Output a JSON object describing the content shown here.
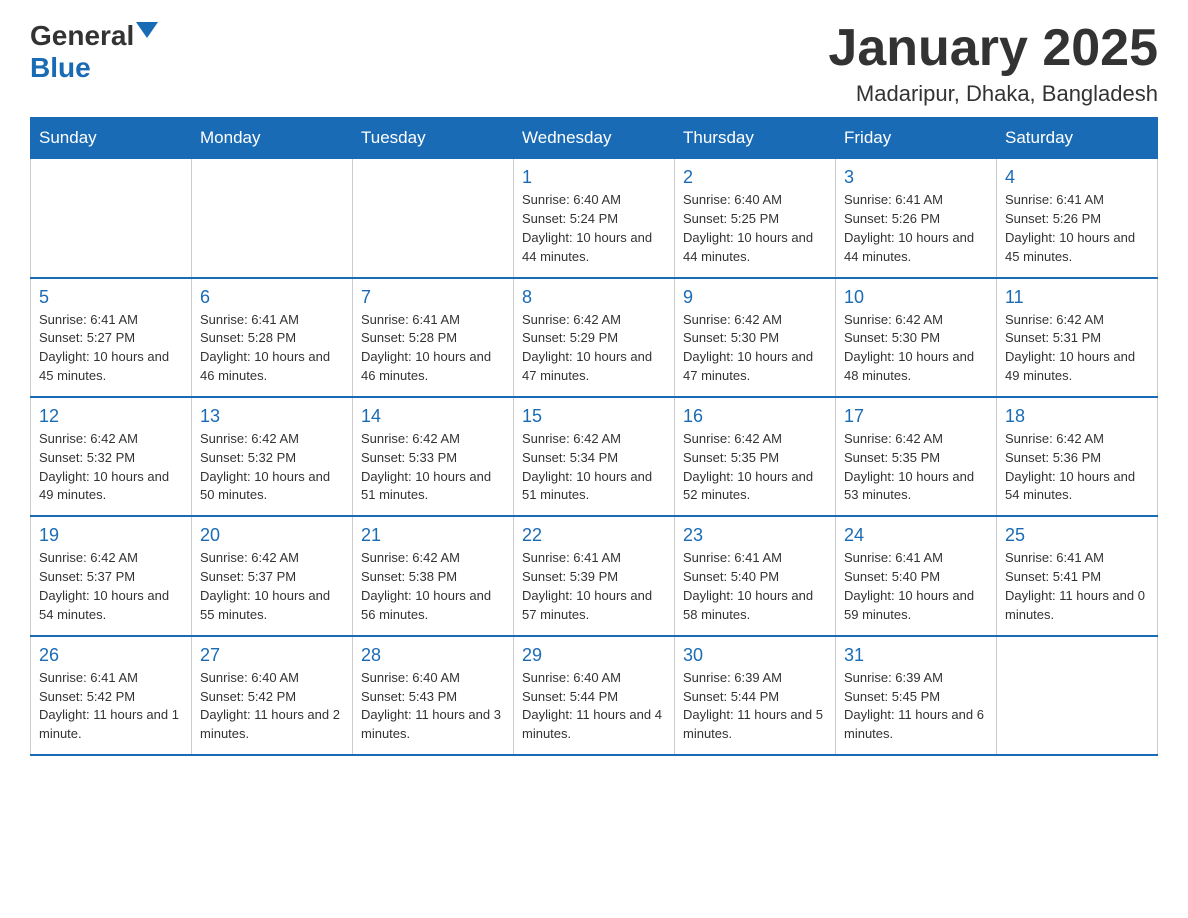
{
  "header": {
    "logo_general": "General",
    "logo_blue": "Blue",
    "title": "January 2025",
    "location": "Madaripur, Dhaka, Bangladesh"
  },
  "days_of_week": [
    "Sunday",
    "Monday",
    "Tuesday",
    "Wednesday",
    "Thursday",
    "Friday",
    "Saturday"
  ],
  "weeks": [
    [
      {
        "day": "",
        "info": ""
      },
      {
        "day": "",
        "info": ""
      },
      {
        "day": "",
        "info": ""
      },
      {
        "day": "1",
        "info": "Sunrise: 6:40 AM\nSunset: 5:24 PM\nDaylight: 10 hours and 44 minutes."
      },
      {
        "day": "2",
        "info": "Sunrise: 6:40 AM\nSunset: 5:25 PM\nDaylight: 10 hours and 44 minutes."
      },
      {
        "day": "3",
        "info": "Sunrise: 6:41 AM\nSunset: 5:26 PM\nDaylight: 10 hours and 44 minutes."
      },
      {
        "day": "4",
        "info": "Sunrise: 6:41 AM\nSunset: 5:26 PM\nDaylight: 10 hours and 45 minutes."
      }
    ],
    [
      {
        "day": "5",
        "info": "Sunrise: 6:41 AM\nSunset: 5:27 PM\nDaylight: 10 hours and 45 minutes."
      },
      {
        "day": "6",
        "info": "Sunrise: 6:41 AM\nSunset: 5:28 PM\nDaylight: 10 hours and 46 minutes."
      },
      {
        "day": "7",
        "info": "Sunrise: 6:41 AM\nSunset: 5:28 PM\nDaylight: 10 hours and 46 minutes."
      },
      {
        "day": "8",
        "info": "Sunrise: 6:42 AM\nSunset: 5:29 PM\nDaylight: 10 hours and 47 minutes."
      },
      {
        "day": "9",
        "info": "Sunrise: 6:42 AM\nSunset: 5:30 PM\nDaylight: 10 hours and 47 minutes."
      },
      {
        "day": "10",
        "info": "Sunrise: 6:42 AM\nSunset: 5:30 PM\nDaylight: 10 hours and 48 minutes."
      },
      {
        "day": "11",
        "info": "Sunrise: 6:42 AM\nSunset: 5:31 PM\nDaylight: 10 hours and 49 minutes."
      }
    ],
    [
      {
        "day": "12",
        "info": "Sunrise: 6:42 AM\nSunset: 5:32 PM\nDaylight: 10 hours and 49 minutes."
      },
      {
        "day": "13",
        "info": "Sunrise: 6:42 AM\nSunset: 5:32 PM\nDaylight: 10 hours and 50 minutes."
      },
      {
        "day": "14",
        "info": "Sunrise: 6:42 AM\nSunset: 5:33 PM\nDaylight: 10 hours and 51 minutes."
      },
      {
        "day": "15",
        "info": "Sunrise: 6:42 AM\nSunset: 5:34 PM\nDaylight: 10 hours and 51 minutes."
      },
      {
        "day": "16",
        "info": "Sunrise: 6:42 AM\nSunset: 5:35 PM\nDaylight: 10 hours and 52 minutes."
      },
      {
        "day": "17",
        "info": "Sunrise: 6:42 AM\nSunset: 5:35 PM\nDaylight: 10 hours and 53 minutes."
      },
      {
        "day": "18",
        "info": "Sunrise: 6:42 AM\nSunset: 5:36 PM\nDaylight: 10 hours and 54 minutes."
      }
    ],
    [
      {
        "day": "19",
        "info": "Sunrise: 6:42 AM\nSunset: 5:37 PM\nDaylight: 10 hours and 54 minutes."
      },
      {
        "day": "20",
        "info": "Sunrise: 6:42 AM\nSunset: 5:37 PM\nDaylight: 10 hours and 55 minutes."
      },
      {
        "day": "21",
        "info": "Sunrise: 6:42 AM\nSunset: 5:38 PM\nDaylight: 10 hours and 56 minutes."
      },
      {
        "day": "22",
        "info": "Sunrise: 6:41 AM\nSunset: 5:39 PM\nDaylight: 10 hours and 57 minutes."
      },
      {
        "day": "23",
        "info": "Sunrise: 6:41 AM\nSunset: 5:40 PM\nDaylight: 10 hours and 58 minutes."
      },
      {
        "day": "24",
        "info": "Sunrise: 6:41 AM\nSunset: 5:40 PM\nDaylight: 10 hours and 59 minutes."
      },
      {
        "day": "25",
        "info": "Sunrise: 6:41 AM\nSunset: 5:41 PM\nDaylight: 11 hours and 0 minutes."
      }
    ],
    [
      {
        "day": "26",
        "info": "Sunrise: 6:41 AM\nSunset: 5:42 PM\nDaylight: 11 hours and 1 minute."
      },
      {
        "day": "27",
        "info": "Sunrise: 6:40 AM\nSunset: 5:42 PM\nDaylight: 11 hours and 2 minutes."
      },
      {
        "day": "28",
        "info": "Sunrise: 6:40 AM\nSunset: 5:43 PM\nDaylight: 11 hours and 3 minutes."
      },
      {
        "day": "29",
        "info": "Sunrise: 6:40 AM\nSunset: 5:44 PM\nDaylight: 11 hours and 4 minutes."
      },
      {
        "day": "30",
        "info": "Sunrise: 6:39 AM\nSunset: 5:44 PM\nDaylight: 11 hours and 5 minutes."
      },
      {
        "day": "31",
        "info": "Sunrise: 6:39 AM\nSunset: 5:45 PM\nDaylight: 11 hours and 6 minutes."
      },
      {
        "day": "",
        "info": ""
      }
    ]
  ]
}
